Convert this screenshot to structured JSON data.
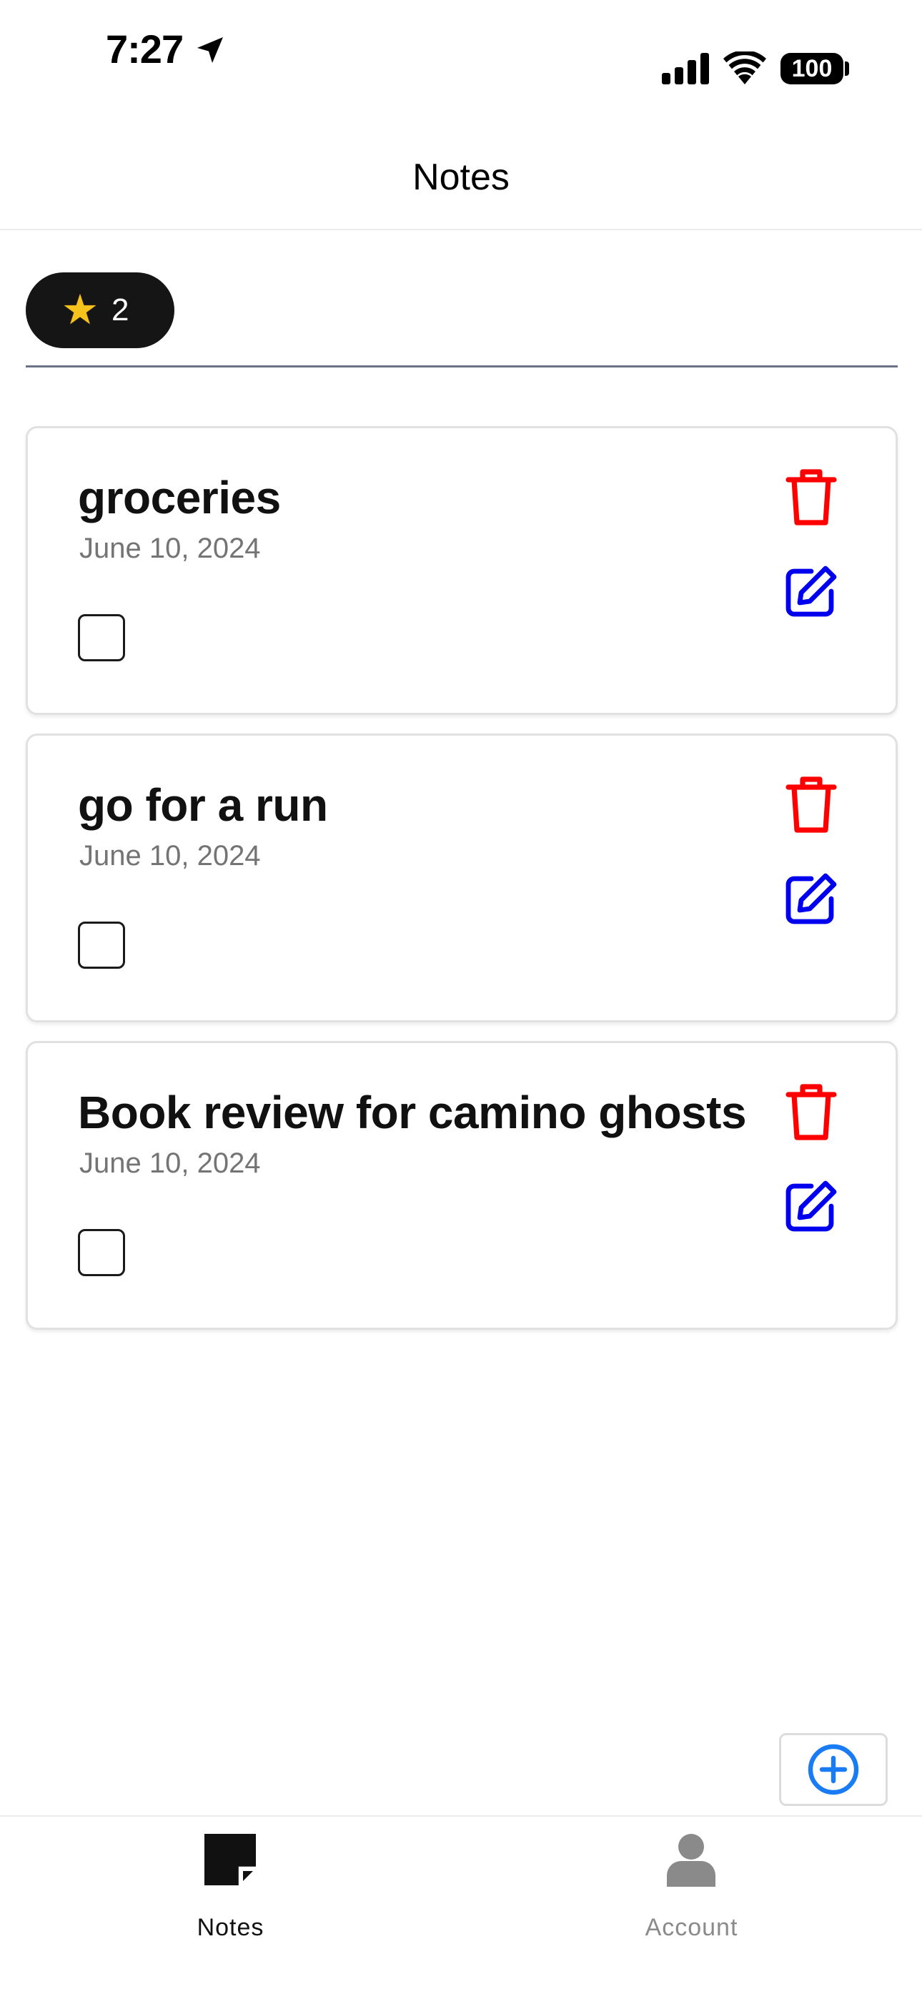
{
  "status_bar": {
    "time": "7:27",
    "battery": "100"
  },
  "header": {
    "title": "Notes"
  },
  "stars": {
    "count": "2"
  },
  "notes": [
    {
      "title": "groceries",
      "date": "June 10, 2024",
      "checked": false
    },
    {
      "title": "go for a run",
      "date": "June 10, 2024",
      "checked": false
    },
    {
      "title": "Book review for camino ghosts",
      "date": "June 10, 2024",
      "checked": false
    }
  ],
  "tabs": [
    {
      "label": "Notes",
      "icon": "note-icon",
      "active": true
    },
    {
      "label": "Account",
      "icon": "person-icon",
      "active": false
    }
  ],
  "colors": {
    "delete": "#ff0000",
    "edit": "#0000ee",
    "add": "#1a7cf5",
    "active_tab": "#111111",
    "inactive_tab": "#8a8a8a"
  }
}
